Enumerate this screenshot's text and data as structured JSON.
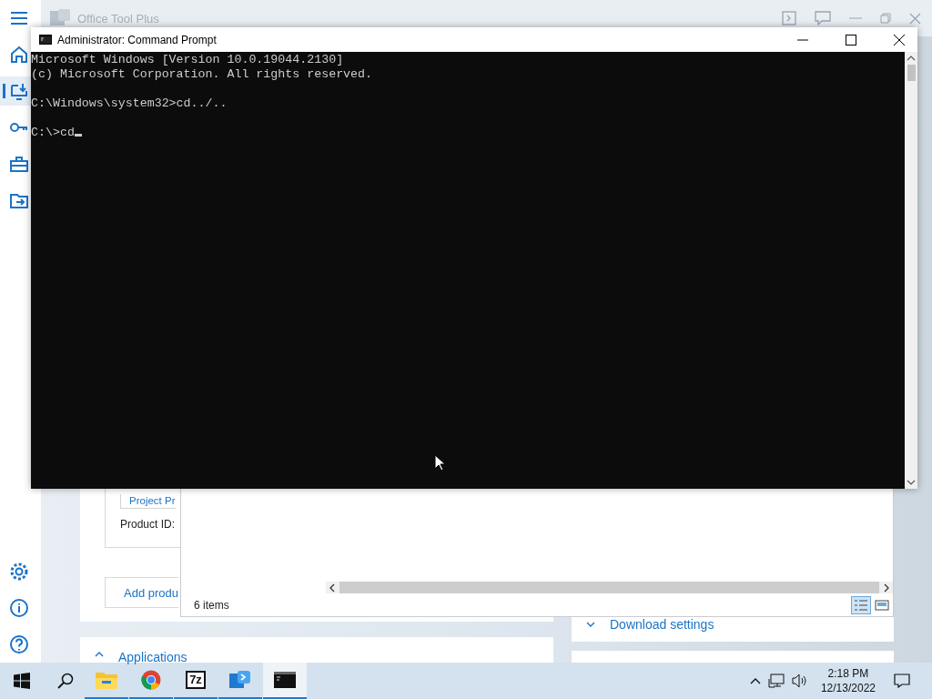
{
  "app": {
    "title": "Office Tool Plus",
    "nav_top": [
      {
        "kind": "menu",
        "selected": false
      },
      {
        "kind": "home",
        "selected": false
      },
      {
        "kind": "deploy",
        "selected": true
      },
      {
        "kind": "activate",
        "selected": false
      },
      {
        "kind": "toolbox",
        "selected": false
      },
      {
        "kind": "convert",
        "selected": false
      }
    ],
    "nav_bottom": [
      {
        "kind": "settings",
        "selected": false
      },
      {
        "kind": "about",
        "selected": false
      },
      {
        "kind": "help",
        "selected": false
      }
    ],
    "product_chip": "Project Pr",
    "product_id_label": "Product ID:",
    "add_button": "Add produ",
    "applications": "Applications",
    "download_settings": "Download settings"
  },
  "console": {
    "title": "Administrator: Command Prompt",
    "blocks": [
      [
        "Microsoft Windows [Version 10.0.19044.2130]",
        "(c) Microsoft Corporation. All rights reserved."
      ],
      [
        "C:\\Windows\\system32>cd../.."
      ],
      [
        "C:\\>cd"
      ]
    ],
    "cursor": true
  },
  "explorer": {
    "status": "6 items"
  },
  "taskbar": {
    "apps": [
      {
        "kind": "files",
        "selected": false
      },
      {
        "kind": "browser",
        "selected": false
      },
      {
        "kind": "archiver",
        "label": "7z",
        "selected": false
      },
      {
        "kind": "office-tool",
        "selected": false
      },
      {
        "kind": "terminal",
        "selected": true
      }
    ],
    "time": "2:18 PM",
    "date": "12/13/2022"
  }
}
